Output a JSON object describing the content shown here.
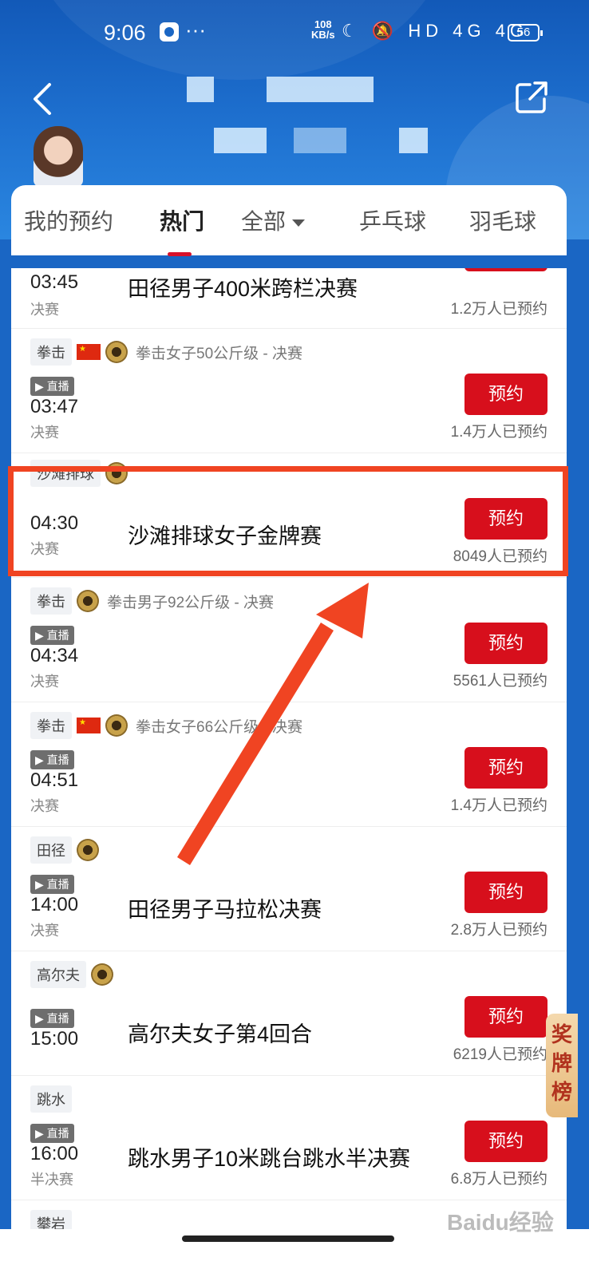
{
  "status_bar": {
    "time": "9:06",
    "more": "···",
    "net_speed": "108",
    "net_unit": "KB/s",
    "icons": "☾ 🔕 HD 4G 4G",
    "battery": "56"
  },
  "header": {
    "back_icon": "chevron-left-icon",
    "share_icon": "share-icon"
  },
  "tabs": [
    {
      "label": "我的预约"
    },
    {
      "label": "热门"
    },
    {
      "label": "全部"
    },
    {
      "label": "乒乓球"
    },
    {
      "label": "羽毛球"
    }
  ],
  "rows": [
    {
      "sport": "",
      "event_sub": "",
      "live": "",
      "time": "03:45",
      "stage": "决赛",
      "title": "田径男子400米跨栏决赛",
      "button": "预约",
      "count": "1.2万人已预约"
    },
    {
      "sport": "拳击",
      "event_sub": "拳击女子50公斤级 - 决赛",
      "live": "▶ 直播",
      "time": "03:47",
      "stage": "决赛",
      "title": "",
      "button": "预约",
      "count": "1.4万人已预约"
    },
    {
      "sport": "沙滩排球",
      "event_sub": "",
      "live": "",
      "time": "04:30",
      "stage": "决赛",
      "title": "沙滩排球女子金牌赛",
      "button": "预约",
      "count": "8049人已预约"
    },
    {
      "sport": "拳击",
      "event_sub": "拳击男子92公斤级 - 决赛",
      "live": "▶ 直播",
      "time": "04:34",
      "stage": "决赛",
      "title": "",
      "button": "预约",
      "count": "5561人已预约"
    },
    {
      "sport": "拳击",
      "event_sub": "拳击女子66公斤级 - 决赛",
      "live": "▶ 直播",
      "time": "04:51",
      "stage": "决赛",
      "title": "",
      "button": "预约",
      "count": "1.4万人已预约"
    },
    {
      "sport": "田径",
      "event_sub": "",
      "live": "▶ 直播",
      "time": "14:00",
      "stage": "决赛",
      "title": "田径男子马拉松决赛",
      "button": "预约",
      "count": "2.8万人已预约"
    },
    {
      "sport": "高尔夫",
      "event_sub": "",
      "live": "▶ 直播",
      "time": "15:00",
      "stage": "",
      "title": "高尔夫女子第4回合",
      "button": "预约",
      "count": "6219人已预约"
    },
    {
      "sport": "跳水",
      "event_sub": "",
      "live": "▶ 直播",
      "time": "16:00",
      "stage": "半决赛",
      "title": "跳水男子10米跳台跳水半决赛",
      "button": "预约",
      "count": "6.8万人已预约"
    },
    {
      "sport": "攀岩",
      "event_sub": "",
      "live": "",
      "time": "",
      "stage": "",
      "title": "",
      "button": "",
      "count": ""
    }
  ],
  "medal_board": "奖牌榜",
  "watermark": "Baidu经验",
  "colors": {
    "accent_red": "#d70f1c",
    "highlight": "#f04422",
    "header_blue": "#1a66c4"
  }
}
